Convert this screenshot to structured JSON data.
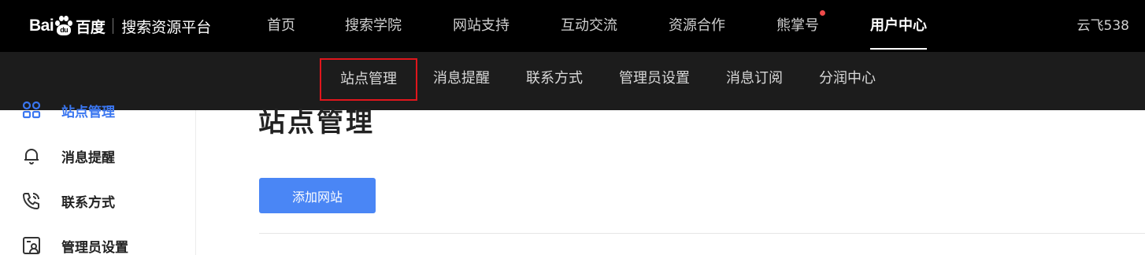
{
  "brand": {
    "logo_left": "Bai",
    "logo_paw_text": "du",
    "logo_cn": "百度",
    "platform": "搜索资源平台"
  },
  "nav": {
    "items": [
      {
        "label": "首页"
      },
      {
        "label": "搜索学院"
      },
      {
        "label": "网站支持"
      },
      {
        "label": "互动交流"
      },
      {
        "label": "资源合作"
      },
      {
        "label": "熊掌号",
        "badge_dot": true
      },
      {
        "label": "用户中心",
        "active": true
      }
    ],
    "user": "云飞538"
  },
  "subnav": {
    "items": [
      {
        "label": "站点管理",
        "highlighted": true
      },
      {
        "label": "消息提醒"
      },
      {
        "label": "联系方式"
      },
      {
        "label": "管理员设置"
      },
      {
        "label": "消息订阅"
      },
      {
        "label": "分润中心"
      }
    ]
  },
  "sidebar": {
    "items": [
      {
        "label": "站点管理",
        "icon": "site-grid-icon",
        "active": true
      },
      {
        "label": "消息提醒",
        "icon": "bell-icon"
      },
      {
        "label": "联系方式",
        "icon": "phone-icon"
      },
      {
        "label": "管理员设置",
        "icon": "admin-card-icon"
      }
    ]
  },
  "main": {
    "title": "站点管理",
    "add_button": "添加网站"
  },
  "colors": {
    "topbar_bg": "#000000",
    "subnav_bg": "#1c1c1c",
    "accent_blue": "#4a86f5",
    "highlight_red": "#e0161c",
    "badge_red": "#f04a4a"
  }
}
